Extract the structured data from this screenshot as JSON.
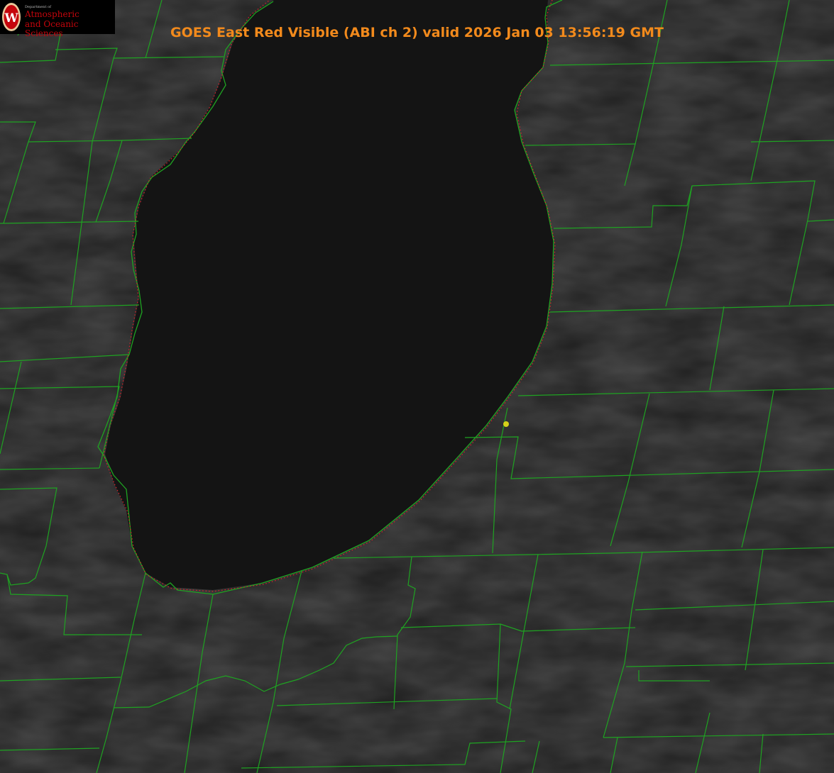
{
  "header": {
    "title": "GOES East Red Visible (ABI ch 2) valid 2026 Jan 03 13:56:19 GMT"
  },
  "logo": {
    "seal_letter": "W",
    "department_label": "Department of",
    "line1": "Atmospheric",
    "line2": "and Oceanic Sciences"
  },
  "colors": {
    "title": "#f28a1c",
    "logo_red": "#c5050c",
    "logo_seal_ring": "#e8c79a",
    "boundary_green": "#1fa322",
    "shoreline_red": "#e0202a",
    "marker_yellow": "#d6d11a",
    "water": "#141414",
    "land": "#1f1f1f"
  },
  "icons": {
    "logo_seal": "uw-crest-icon",
    "marker": "location-marker-icon"
  }
}
